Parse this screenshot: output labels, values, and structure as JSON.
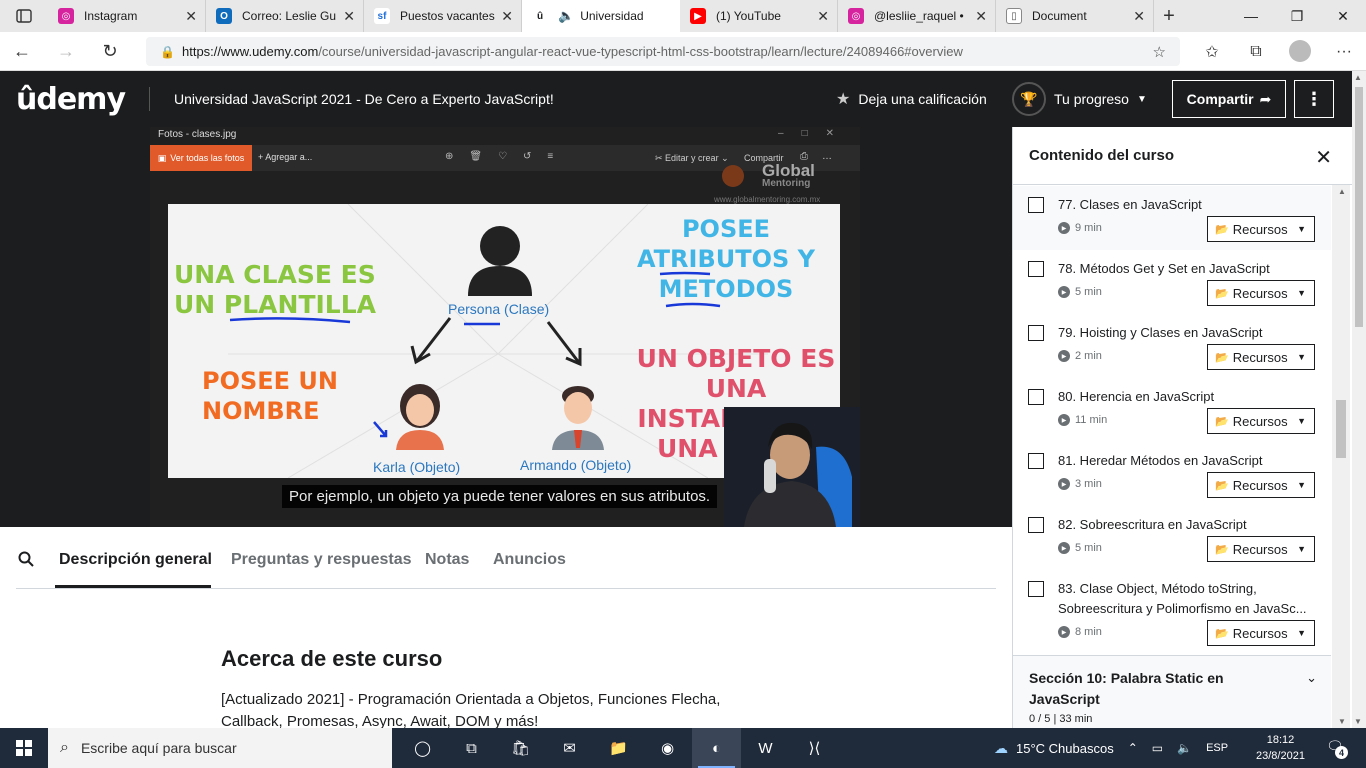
{
  "browser": {
    "tabs": [
      {
        "title": "Instagram",
        "favicon_color": "#d6249f",
        "icon": "instagram-icon"
      },
      {
        "title": "Correo: Leslie Gu",
        "favicon_color": "#0f6cbd",
        "icon": "outlook-icon"
      },
      {
        "title": "Puestos vacantes",
        "favicon_color": "#1e6fd9",
        "icon": "sf-icon"
      },
      {
        "title": "Universidad",
        "favicon_color": "#1c1d1f",
        "icon": "udemy-icon",
        "active": true
      },
      {
        "title": "(1) YouTube",
        "favicon_color": "#ff0000",
        "icon": "youtube-icon"
      },
      {
        "title": "@lesliie_raquel •",
        "favicon_color": "#d6249f",
        "icon": "instagram-icon"
      },
      {
        "title": "Document",
        "favicon_color": "#888888",
        "icon": "document-icon"
      }
    ],
    "url_host": "https://www.udemy.com",
    "url_path": "/course/universidad-javascript-angular-react-vue-typescript-html-css-bootstrap/learn/lecture/24089466#overview"
  },
  "header": {
    "logo": "ûdemy",
    "course_title": "Universidad JavaScript 2021 - De Cero a Experto JavaScript!",
    "rate_label": "Deja una calificación",
    "progress_label": "Tu progreso",
    "share_label": "Compartir",
    "more_label": "⋮"
  },
  "video": {
    "photos_title": "Fotos - clases.jpg",
    "see_all": "Ver todas las fotos",
    "add_to": "Agregar a...",
    "edit_create": "Editar y crear",
    "share": "Compartir",
    "watermark_1": "Global",
    "watermark_2": "Mentoring",
    "watermark_url": "www.globalmentoring.com.mx",
    "slide": {
      "green": "UNA CLASE ES\nUN PLANTILLA",
      "orange": "POSEE UN\nNOMBRE",
      "blue": "POSEE\nATRIBUTOS Y\nMETODOS",
      "red": "UN OBJETO ES\nUNA\nINSTANCIA DE\nUNA CLASE",
      "persona": "Persona (Clase)",
      "karla": "Karla (Objeto)",
      "armando": "Armando (Objeto)"
    },
    "caption": "Por ejemplo, un objeto ya puede tener valores en sus atributos."
  },
  "course_tabs": [
    {
      "label": "Descripción general",
      "active": true
    },
    {
      "label": "Preguntas y respuestas"
    },
    {
      "label": "Notas"
    },
    {
      "label": "Anuncios"
    }
  ],
  "about": {
    "title": "Acerca de este curso",
    "text": "[Actualizado 2021] - Programación Orientada a Objetos, Funciones Flecha, Callback, Promesas, Async, Await, DOM y más!"
  },
  "sidebar": {
    "title": "Contenido del curso",
    "resources_label": "Recursos",
    "lectures": [
      {
        "title": "77. Clases en JavaScript",
        "duration": "9 min",
        "highlight": true
      },
      {
        "title": "78. Métodos Get y Set en JavaScript",
        "duration": "5 min"
      },
      {
        "title": "79. Hoisting y Clases en JavaScript",
        "duration": "2 min"
      },
      {
        "title": "80. Herencia en JavaScript",
        "duration": "11 min"
      },
      {
        "title": "81. Heredar Métodos en JavaScript",
        "duration": "3 min"
      },
      {
        "title": "82. Sobreescritura en JavaScript",
        "duration": "5 min"
      },
      {
        "title": "83. Clase Object, Método toString, Sobreescritura y Polimorfismo en JavaSc...",
        "duration": "8 min"
      }
    ],
    "section": {
      "title": "Sección 10: Palabra Static en JavaScript",
      "meta": "0 / 5 | 33 min"
    }
  },
  "taskbar": {
    "search_placeholder": "Escribe aquí para buscar",
    "weather": "15°C  Chubascos",
    "lang": "ESP",
    "time": "18:12",
    "date": "23/8/2021",
    "notif_count": "4"
  }
}
